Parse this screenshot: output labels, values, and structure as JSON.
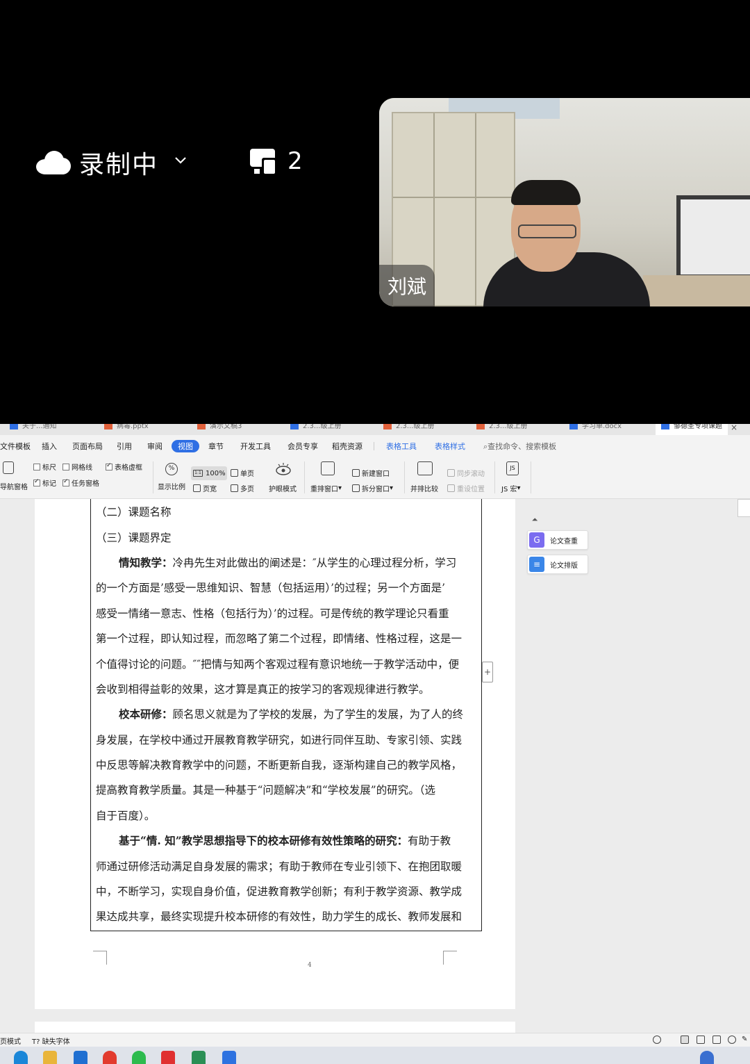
{
  "meeting": {
    "recording_label": "录制中",
    "share_count": "2",
    "participant_name": "刘斌"
  },
  "doc_tabs": [
    {
      "label": "关于...通知",
      "color": "#2f6fe4"
    },
    {
      "label": "病毒.pptx",
      "color": "#e0603a"
    },
    {
      "label": "演示文稿3",
      "color": "#e0603a"
    },
    {
      "label": "2.3...级上册",
      "color": "#2f6fe4"
    },
    {
      "label": "2.3...级上册",
      "color": "#e0603a"
    },
    {
      "label": "2.3...级上册",
      "color": "#e0603a"
    },
    {
      "label": "学习单.docx",
      "color": "#2f6fe4"
    },
    {
      "label": "邹德圣专项课题",
      "color": "#2f6fe4"
    }
  ],
  "menu": {
    "items": [
      "文件模板",
      "插入",
      "页面布局",
      "引用",
      "审阅",
      "视图",
      "章节",
      "开发工具",
      "会员专享",
      "稻壳资源"
    ],
    "active": "视图",
    "table_tools": "表格工具",
    "table_style": "表格样式",
    "search": "查找命令、搜索模板"
  },
  "toolbar": {
    "nav_pane": "导航窗格",
    "ruler": "标尺",
    "gridlines": "网格线",
    "table_gridlines": "表格虚框",
    "marks": "标记",
    "task_pane": "任务窗格",
    "zoom_display": "显示比例",
    "zoom_value": "100%",
    "page_width": "页宽",
    "single_page": "单页",
    "multi_page": "多页",
    "eye_mode": "护眼模式",
    "arrange": "重排窗口",
    "new_window": "新建窗口",
    "split_window": "拆分窗口",
    "side_by_side": "并排比较",
    "sync_scroll": "同步滚动",
    "reset_position": "重设位置",
    "macro": "JS 宏"
  },
  "document": {
    "lines": [
      {
        "text": "（二）课题名称"
      },
      {
        "text": "（三）课题界定"
      },
      {
        "bold": "情知教学：",
        "text": "冷冉先生对此做出的阐述是：″从学生的心理过程分析，学习"
      },
      {
        "text": "的一个方面是’感受一思维知识、智慧（包括运用）’的过程；另一个方面是’"
      },
      {
        "text": "感受一情绪一意志、性格（包括行为）’的过程。可是传统的教学理论只看重"
      },
      {
        "text": "第一个过程，即认知过程，而忽略了第二个过程，即情绪、性格过程，这是一"
      },
      {
        "text": "个值得讨论的问题。″″把情与知两个客观过程有意识地统一于教学活动中，便"
      },
      {
        "text": "会收到相得益彰的效果，这才算是真正的按学习的客观规律进行教学。"
      },
      {
        "bold": "校本研修：",
        "text": "顾名思义就是为了学校的发展，为了学生的发展，为了人的终"
      },
      {
        "text": "身发展，在学校中通过开展教育教学研究，如进行同伴互助、专家引领、实践"
      },
      {
        "text": "中反思等解决教育教学中的问题，不断更新自我，逐渐构建自己的教学风格，"
      },
      {
        "text": "提高教育教学质量。其是一种基于“问题解决”和“学校发展”的研究。（选"
      },
      {
        "text": "自于百度）。"
      },
      {
        "bold": "基于“情. 知”教学思想指导下的校本研修有效性策略的研究：",
        "text": "有助于教"
      },
      {
        "text": "师通过研修活动满足自身发展的需求；有助于教师在专业引领下、在抱团取暖"
      },
      {
        "text": "中，不断学习，实现自身价值，促进教育教学创新；有利于教学资源、教学成"
      },
      {
        "text": "果达成共享，最终实现提升校本研修的有效性，助力学生的成长、教师发展和"
      }
    ],
    "page_number": "4"
  },
  "side_panel": {
    "plagiarism_check": "论文查重",
    "paper_format": "论文排版"
  },
  "statusbar": {
    "mode": "页模式",
    "missing_font": "缺失字体"
  }
}
